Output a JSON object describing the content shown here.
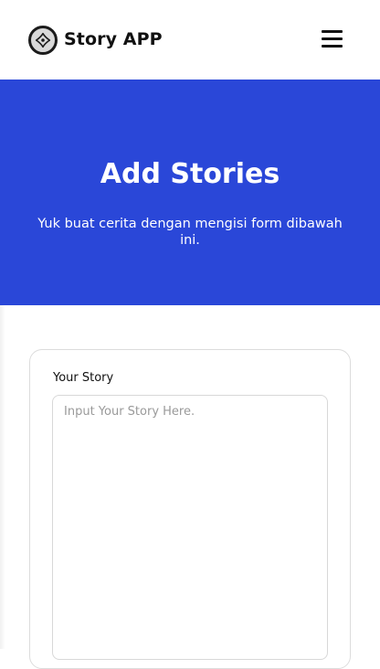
{
  "header": {
    "brand": "Story APP",
    "logo_icon": "sparkle-logo-icon",
    "menu_icon": "hamburger-menu-icon"
  },
  "hero": {
    "title": "Add Stories",
    "subtitle": "Yuk buat cerita dengan mengisi form dibawah ini.",
    "background": "#2a47d8"
  },
  "form": {
    "story_label": "Your Story",
    "story_placeholder": "Input Your Story Here.",
    "story_value": ""
  }
}
